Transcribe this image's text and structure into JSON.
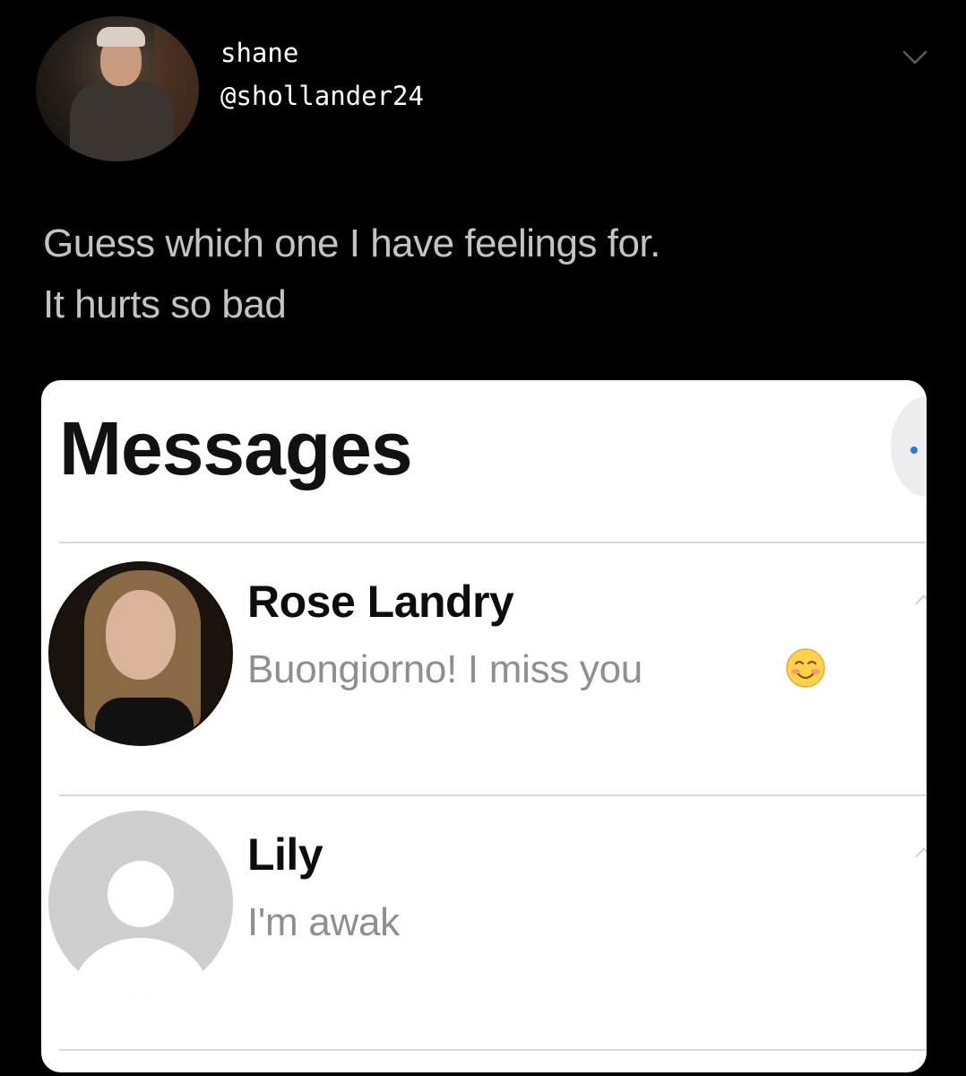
{
  "tweet": {
    "author_name": "shane",
    "author_handle": "@shollander24",
    "text": "Guess which one I have feelings for.\nIt hurts so bad"
  },
  "messages_screen": {
    "title": "Messages",
    "conversations": [
      {
        "name": "Rose Landry",
        "preview": "Buongiorno! I miss you",
        "avatar": "photo",
        "trailing_emoji": "smiling-face-icon"
      },
      {
        "name": "Lily",
        "preview": "I'm awak",
        "avatar": "default-contact-icon"
      }
    ],
    "accent_color": "#1f7cf0"
  },
  "colors": {
    "background": "#000000",
    "tweet_text": "#c3c3c3",
    "card": "#ffffff",
    "preview_text": "#8e8e93"
  }
}
